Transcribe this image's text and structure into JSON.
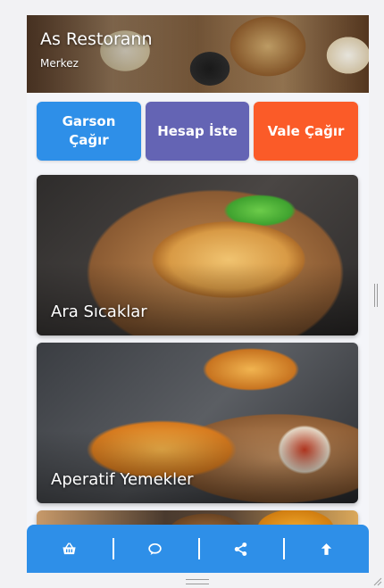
{
  "restaurant": {
    "name": "As Restorann",
    "branch": "Merkez"
  },
  "actions": {
    "call_waiter": "Garson\nÇağır",
    "request_bill": "Hesap İste",
    "call_valet": "Vale Çağır"
  },
  "categories": [
    {
      "label": "Ara Sıcaklar"
    },
    {
      "label": "Aperatif Yemekler"
    },
    {
      "label": ""
    }
  ],
  "bottom_bar": {
    "icons": [
      "basket-icon",
      "chat-icon",
      "share-icon",
      "arrow-up-icon"
    ]
  },
  "colors": {
    "primary": "#2e8fe8",
    "bill": "#6464b4",
    "valet": "#fb5b28"
  }
}
